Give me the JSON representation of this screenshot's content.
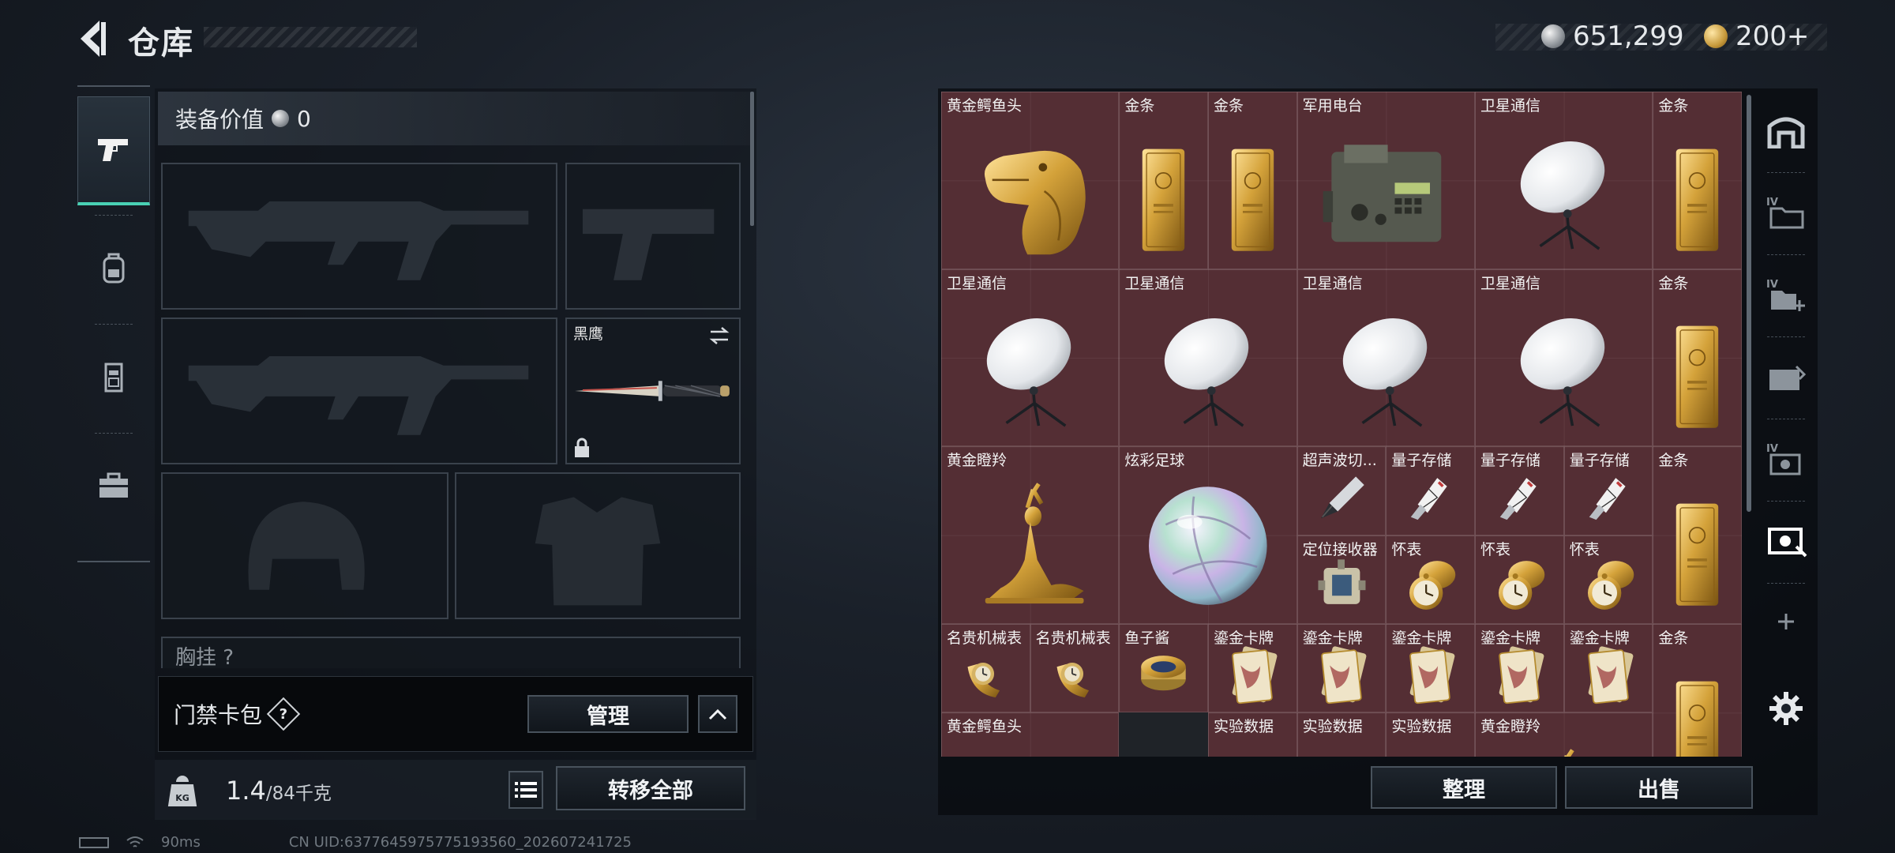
{
  "header": {
    "title": "仓库"
  },
  "currency": {
    "coins": "651,299",
    "tickets": "200+"
  },
  "equipment": {
    "value_label": "装备价值",
    "value": "0",
    "melee_name": "黑鹰",
    "chest_label": "胸挂"
  },
  "card_pack": {
    "label": "门禁卡包",
    "help": "?",
    "manage_label": "管理"
  },
  "capacity": {
    "current": "1.4",
    "max": "/84千克",
    "transfer_label": "转移全部"
  },
  "status": {
    "ping": "90ms",
    "uid": "CN UID:6377645975775193560_202607241725"
  },
  "stash": {
    "sort_label": "整理",
    "sell_label": "出售",
    "items": [
      {
        "name": "黄金鳄鱼头",
        "icon": "gold-croc-head"
      },
      {
        "name": "金条",
        "icon": "gold-bar"
      },
      {
        "name": "金条",
        "icon": "gold-bar"
      },
      {
        "name": "军用电台",
        "icon": "military-radio"
      },
      {
        "name": "卫星通信",
        "icon": "satellite-dish"
      },
      {
        "name": "金条",
        "icon": "gold-bar"
      },
      {
        "name": "卫星通信",
        "icon": "satellite-dish"
      },
      {
        "name": "卫星通信",
        "icon": "satellite-dish"
      },
      {
        "name": "卫星通信",
        "icon": "satellite-dish"
      },
      {
        "name": "卫星通信",
        "icon": "satellite-dish"
      },
      {
        "name": "金条",
        "icon": "gold-bar"
      },
      {
        "name": "黄金瞪羚",
        "icon": "gold-gazelle"
      },
      {
        "name": "炫彩足球",
        "icon": "iridescent-ball"
      },
      {
        "name": "超声波切...",
        "icon": "ultrasonic-cutter"
      },
      {
        "name": "量子存储",
        "icon": "quantum-storage"
      },
      {
        "name": "量子存储",
        "icon": "quantum-storage"
      },
      {
        "name": "量子存储",
        "icon": "quantum-storage"
      },
      {
        "name": "金条",
        "icon": "gold-bar"
      },
      {
        "name": "定位接收器",
        "icon": "gps-receiver"
      },
      {
        "name": "怀表",
        "icon": "pocket-watch"
      },
      {
        "name": "怀表",
        "icon": "pocket-watch"
      },
      {
        "name": "怀表",
        "icon": "pocket-watch"
      },
      {
        "name": "名贵机械表",
        "icon": "luxury-watch"
      },
      {
        "name": "名贵机械表",
        "icon": "luxury-watch"
      },
      {
        "name": "鱼子酱",
        "icon": "caviar-tin"
      },
      {
        "name": "鎏金卡牌",
        "icon": "gilded-card"
      },
      {
        "name": "鎏金卡牌",
        "icon": "gilded-card"
      },
      {
        "name": "鎏金卡牌",
        "icon": "gilded-card"
      },
      {
        "name": "鎏金卡牌",
        "icon": "gilded-card"
      },
      {
        "name": "鎏金卡牌",
        "icon": "gilded-card"
      },
      {
        "name": "金条",
        "icon": "gold-bar"
      },
      {
        "name": "黄金鳄鱼头",
        "icon": "gold-croc-head"
      },
      {
        "name": "实验数据",
        "icon": "data-disc"
      },
      {
        "name": "实验数据",
        "icon": "data-disc"
      },
      {
        "name": "实验数据",
        "icon": "data-disc"
      },
      {
        "name": "黄金瞪羚",
        "icon": "gold-gazelle"
      }
    ]
  },
  "colors": {
    "accent": "#49d1b4",
    "grid_bg": "#4a2a30",
    "gold": "#c9962f"
  }
}
